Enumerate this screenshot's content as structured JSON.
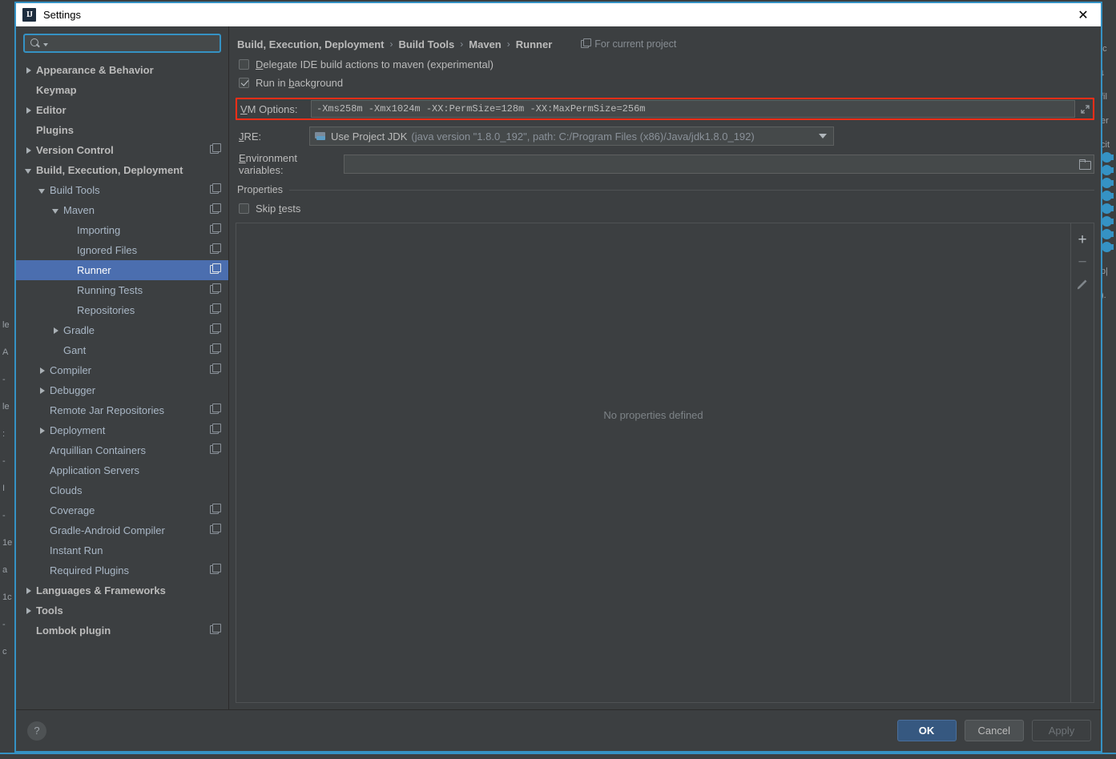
{
  "window": {
    "title": "Settings",
    "icon": "intellij-idea-icon",
    "close_label": "✕"
  },
  "search": {
    "value": "",
    "placeholder": "",
    "icon": "search-icon"
  },
  "sidebar": {
    "items": [
      {
        "label": "Appearance & Behavior",
        "level": 0,
        "arrow": "collapsed",
        "project_icon": false,
        "selected": false
      },
      {
        "label": "Keymap",
        "level": 0,
        "arrow": "none",
        "project_icon": false,
        "selected": false
      },
      {
        "label": "Editor",
        "level": 0,
        "arrow": "collapsed",
        "project_icon": false,
        "selected": false
      },
      {
        "label": "Plugins",
        "level": 0,
        "arrow": "none",
        "project_icon": false,
        "selected": false
      },
      {
        "label": "Version Control",
        "level": 0,
        "arrow": "collapsed",
        "project_icon": true,
        "selected": false
      },
      {
        "label": "Build, Execution, Deployment",
        "level": 0,
        "arrow": "expanded",
        "project_icon": false,
        "selected": false
      },
      {
        "label": "Build Tools",
        "level": 1,
        "arrow": "expanded",
        "project_icon": true,
        "selected": false
      },
      {
        "label": "Maven",
        "level": 2,
        "arrow": "expanded",
        "project_icon": true,
        "selected": false
      },
      {
        "label": "Importing",
        "level": 3,
        "arrow": "none",
        "project_icon": true,
        "selected": false
      },
      {
        "label": "Ignored Files",
        "level": 3,
        "arrow": "none",
        "project_icon": true,
        "selected": false
      },
      {
        "label": "Runner",
        "level": 3,
        "arrow": "none",
        "project_icon": true,
        "selected": true
      },
      {
        "label": "Running Tests",
        "level": 3,
        "arrow": "none",
        "project_icon": true,
        "selected": false
      },
      {
        "label": "Repositories",
        "level": 3,
        "arrow": "none",
        "project_icon": true,
        "selected": false
      },
      {
        "label": "Gradle",
        "level": 2,
        "arrow": "collapsed",
        "project_icon": true,
        "selected": false
      },
      {
        "label": "Gant",
        "level": 2,
        "arrow": "none",
        "project_icon": true,
        "selected": false
      },
      {
        "label": "Compiler",
        "level": 1,
        "arrow": "collapsed",
        "project_icon": true,
        "selected": false
      },
      {
        "label": "Debugger",
        "level": 1,
        "arrow": "collapsed",
        "project_icon": false,
        "selected": false
      },
      {
        "label": "Remote Jar Repositories",
        "level": 1,
        "arrow": "none",
        "project_icon": true,
        "selected": false
      },
      {
        "label": "Deployment",
        "level": 1,
        "arrow": "collapsed",
        "project_icon": true,
        "selected": false
      },
      {
        "label": "Arquillian Containers",
        "level": 1,
        "arrow": "none",
        "project_icon": true,
        "selected": false
      },
      {
        "label": "Application Servers",
        "level": 1,
        "arrow": "none",
        "project_icon": false,
        "selected": false
      },
      {
        "label": "Clouds",
        "level": 1,
        "arrow": "none",
        "project_icon": false,
        "selected": false
      },
      {
        "label": "Coverage",
        "level": 1,
        "arrow": "none",
        "project_icon": true,
        "selected": false
      },
      {
        "label": "Gradle-Android Compiler",
        "level": 1,
        "arrow": "none",
        "project_icon": true,
        "selected": false
      },
      {
        "label": "Instant Run",
        "level": 1,
        "arrow": "none",
        "project_icon": false,
        "selected": false
      },
      {
        "label": "Required Plugins",
        "level": 1,
        "arrow": "none",
        "project_icon": true,
        "selected": false
      },
      {
        "label": "Languages & Frameworks",
        "level": 0,
        "arrow": "collapsed",
        "project_icon": false,
        "selected": false
      },
      {
        "label": "Tools",
        "level": 0,
        "arrow": "collapsed",
        "project_icon": false,
        "selected": false
      },
      {
        "label": "Lombok plugin",
        "level": 0,
        "arrow": "none",
        "project_icon": true,
        "selected": false
      }
    ]
  },
  "content": {
    "breadcrumb": [
      "Build, Execution, Deployment",
      "Build Tools",
      "Maven",
      "Runner"
    ],
    "breadcrumb_separator": "›",
    "for_current_project": "For current project",
    "delegate_checkbox": {
      "label_pre": "D",
      "label_post": "elegate IDE build actions to maven (experimental)",
      "checked": false
    },
    "run_background_checkbox": {
      "label_pre": "Run in ",
      "mnemonic": "b",
      "label_post": "ackground",
      "checked": true
    },
    "vm_options": {
      "label_pre": "V",
      "label_post": "M Options:",
      "value": "-Xms258m -Xmx1024m -XX:PermSize=128m -XX:MaxPermSize=256m",
      "expand_icon": "expand-icon",
      "highlight_color": "#ff2e17"
    },
    "jre": {
      "label_pre": "J",
      "label_post": "RE:",
      "selected_main": "Use Project JDK",
      "selected_detail": "(java version \"1.8.0_192\", path: C:/Program Files (x86)/Java/jdk1.8.0_192)"
    },
    "environment_variables": {
      "label_pre": "E",
      "label_post": "nvironment variables:",
      "value": "",
      "placeholder": "",
      "browse_icon": "folder-icon"
    },
    "properties": {
      "group_title": "Properties",
      "skip_tests": {
        "label_pre": "Skip ",
        "mnemonic": "t",
        "label_post": "ests",
        "checked": false
      },
      "empty_text": "No properties defined",
      "toolbar": {
        "add_label": "+",
        "remove_label": "−",
        "edit_icon": "pencil-icon"
      }
    }
  },
  "footer": {
    "help_label": "?",
    "ok_label": "OK",
    "cancel_label": "Cancel",
    "apply_label": "Apply",
    "apply_disabled": true
  },
  "background": {
    "left_fragments": [
      "le",
      "A",
      "-",
      "le",
      ":",
      "-",
      "I",
      "-",
      "1e",
      "a",
      "1c",
      "-",
      "c"
    ],
    "right_fragments": [
      "'c",
      "↓",
      "fil",
      "er",
      "cit",
      "gear",
      "gear",
      "gear",
      "gear",
      "gear",
      "gear",
      "gear",
      "gear",
      "p|",
      ")."
    ]
  },
  "colors": {
    "accent": "#3592c4",
    "selection": "#4b6eaf",
    "dialog_bg": "#3c3f41",
    "field_bg": "#45494a",
    "text": "#bbbbbb",
    "muted_text": "#8a9199",
    "highlight_red": "#ff2e17",
    "ok_button": "#365880"
  }
}
